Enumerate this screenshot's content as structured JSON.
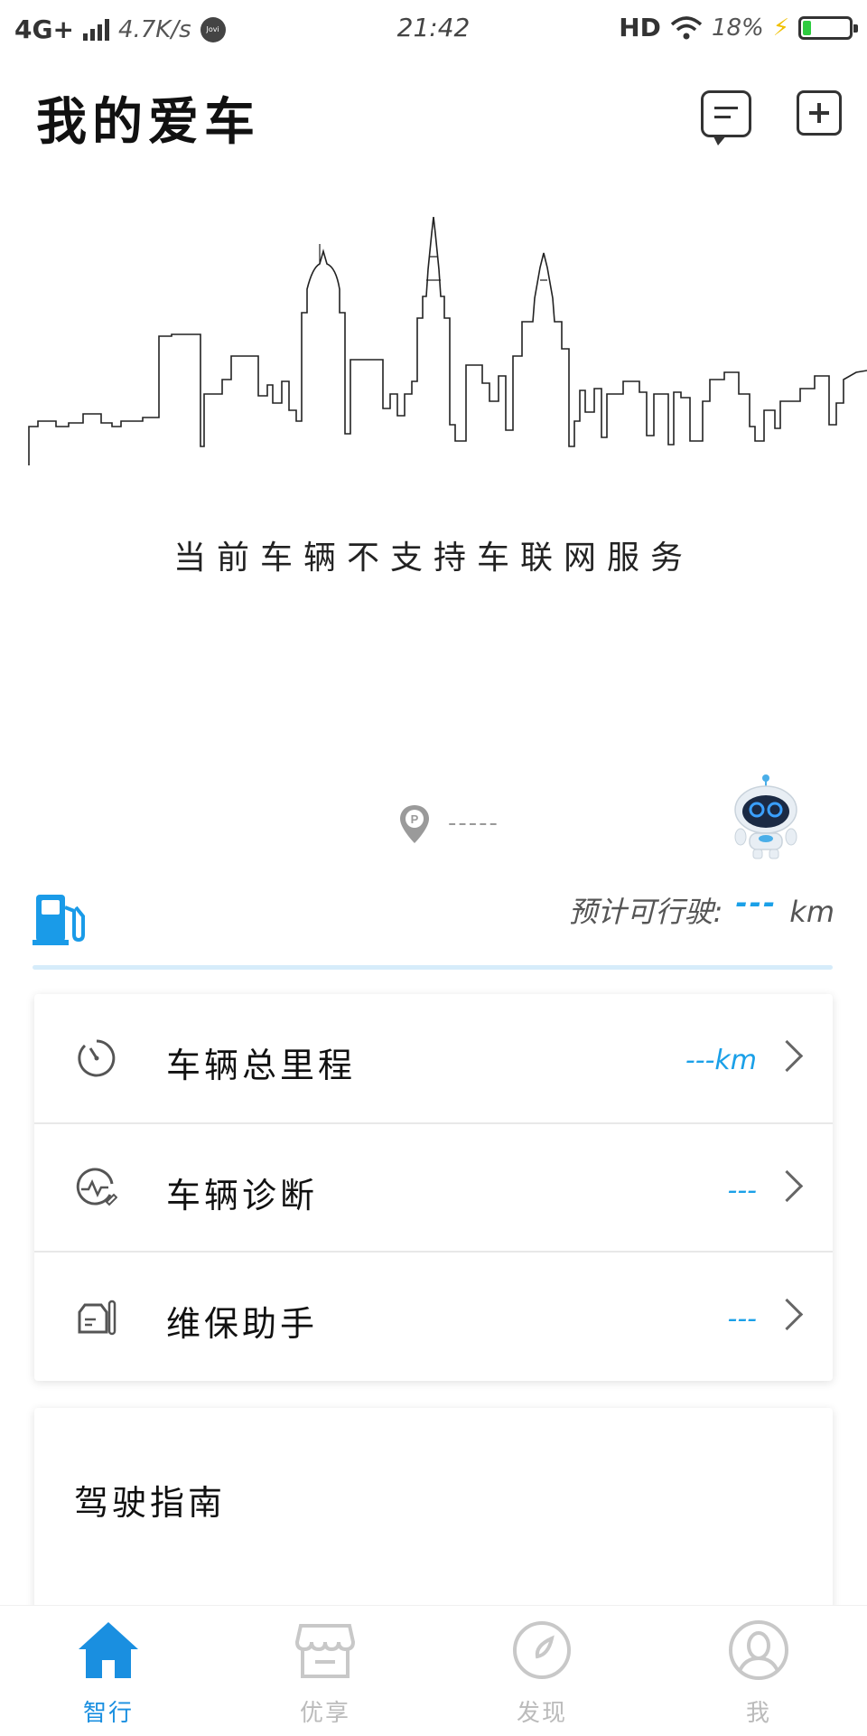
{
  "status_bar": {
    "network": "4G+",
    "speed": "4.7K/s",
    "jovi": "Jovi",
    "time": "21:42",
    "hd": "HD",
    "battery_percent": "18%",
    "battery_level": 0.18
  },
  "header": {
    "title": "我的爱车",
    "message_icon": "message-icon",
    "add_icon": "add-icon"
  },
  "banner": {
    "illustration": "city-skyline",
    "notice": "当前车辆不支持车联网服务"
  },
  "location": {
    "icon": "parking-pin-icon",
    "text": "-----",
    "mascot": "robot-mascot"
  },
  "fuel": {
    "icon": "fuel-pump-icon",
    "range_label": "预计可行驶:",
    "range_value": "---",
    "range_unit": "km"
  },
  "vehicle_list": [
    {
      "icon": "gauge-icon",
      "label": "车辆总里程",
      "value": "---km"
    },
    {
      "icon": "diagnosis-icon",
      "label": "车辆诊断",
      "value": "---"
    },
    {
      "icon": "maintenance-icon",
      "label": "维保助手",
      "value": "---"
    }
  ],
  "guide": {
    "title": "驾驶指南"
  },
  "bottom_nav": [
    {
      "label": "智行",
      "icon": "home-icon",
      "active": true
    },
    {
      "label": "优享",
      "icon": "store-icon",
      "active": false
    },
    {
      "label": "发现",
      "icon": "compass-icon",
      "active": false
    },
    {
      "label": "我",
      "icon": "profile-icon",
      "active": false
    }
  ],
  "colors": {
    "accent": "#1a8fe0",
    "value_blue": "#1aa0e8",
    "divider": "#d6ecfa",
    "inactive": "#bbbbbb"
  }
}
